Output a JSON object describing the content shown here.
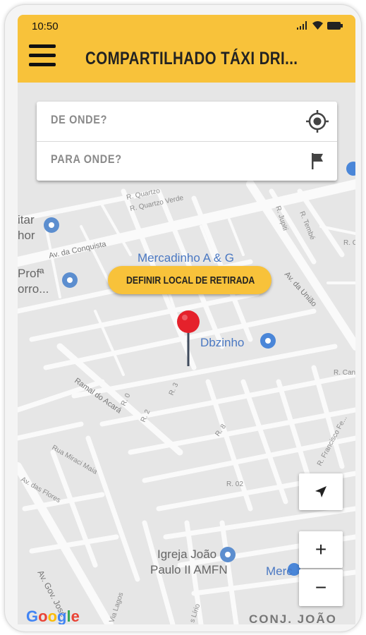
{
  "status": {
    "time": "10:50",
    "icons": [
      "signal-icon",
      "wifi-icon",
      "battery-icon"
    ]
  },
  "header": {
    "title": "COMPARTILHADO TÁXI DRI...",
    "menu_icon": "hamburger-menu-icon",
    "color": "#f8c23a"
  },
  "search": {
    "from_placeholder": "DE ONDE?",
    "to_placeholder": "PARA ONDE?",
    "from_icon": "my-location-icon",
    "to_icon": "flag-icon"
  },
  "pickup_button": {
    "label": "DEFINIR LOCAL DE RETIRADA"
  },
  "map": {
    "pin_icon": "location-pin-icon",
    "pin_color": "#e5212b",
    "labels": {
      "r_quartzo": "R. Quartzo",
      "r_quartzo_verde": "R. Quartzo Verde",
      "av_conquista": "Av. da Conquista",
      "itar": "itar",
      "hor": "hor",
      "mercadinho_ag": "Mercadinho A & G",
      "profa": "Profª",
      "orro": "orro...",
      "av_uniao": "Av. da União",
      "r_jupiti": "R. Jupiti",
      "r_tembe": "R. Tembé",
      "r_c": "R. C",
      "dbzinho": "Dbzinho",
      "r_can": "R. Can",
      "ramal_acara": "Ramal do Acará",
      "r_0": "R. 0",
      "r_2": "R. 2",
      "r_3": "R. 3",
      "r_8": "R. 8",
      "r_francisco": "R. Francisco Fe...",
      "rua_miraci": "Rua Miraci Maia",
      "av_flores": "Av. das Flores",
      "r_02": "R. 02",
      "igreja_l1": "Igreja João",
      "igreja_l2": "Paulo II AMFN",
      "merc": "Merc",
      "av_gov_jose": "Av. Gov. José",
      "via_lagos": "Via Lagos",
      "s_lirio": "s Lírio",
      "conj_joao": "CONJ. JOÃO",
      "google": "Google"
    }
  },
  "controls": {
    "locate_icon": "navigation-arrow-icon",
    "zoom_in": "+",
    "zoom_out": "−"
  }
}
